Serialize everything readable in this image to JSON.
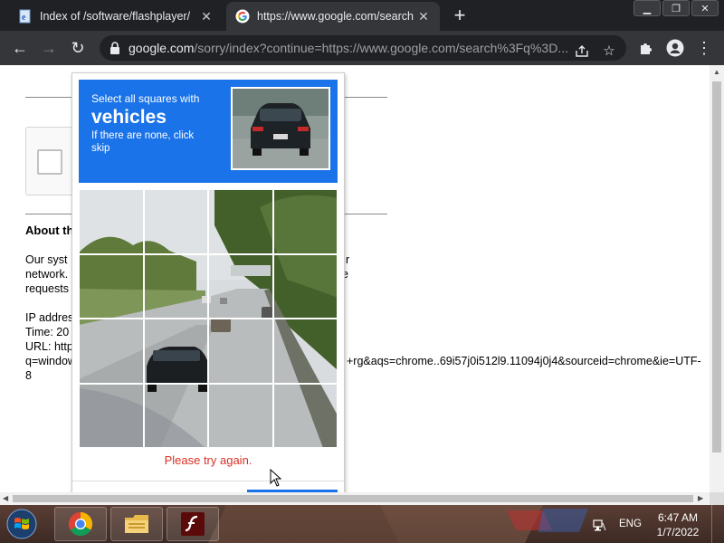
{
  "tabs": [
    {
      "title": "Index of /software/flashplayer/",
      "icon": "ie-document-icon",
      "active": false
    },
    {
      "title": "https://www.google.com/search",
      "icon": "google-icon",
      "active": true
    }
  ],
  "toolbar": {
    "url_host": "google.com",
    "url_rest": "/sorry/index?continue=https://www.google.com/search%3Fq%3D..."
  },
  "page": {
    "about_heading": "About th",
    "para_line1": "Our syst",
    "para_line1_tail": "r",
    "para_line2": "network.",
    "para_line2_tail": "e",
    "para_line3": "requests",
    "ip_label": "IP addres",
    "time_label": "Time: 20",
    "url_label": "URL: http",
    "url_line2_left": "q=window",
    "url_line2_right": "+rg&aqs=chrome..69i57j0i512l9.11094j0j4&sourceid=chrome&ie=UTF-",
    "url_line3": "8"
  },
  "captcha": {
    "instruction": "Select all squares with",
    "target": "vehicles",
    "hint": "If there are none, click skip",
    "error": "Please try again.",
    "grid_size": 4
  },
  "taskbar": {
    "language": "ENG",
    "time": "6:47 AM",
    "date": "1/7/2022",
    "pinned": [
      "chrome-icon",
      "file-explorer-icon",
      "flash-player-icon"
    ]
  },
  "colors": {
    "chrome_dark": "#202124",
    "chrome_toolbar": "#35363a",
    "captcha_blue": "#1a73e8",
    "error_red": "#d93025"
  }
}
